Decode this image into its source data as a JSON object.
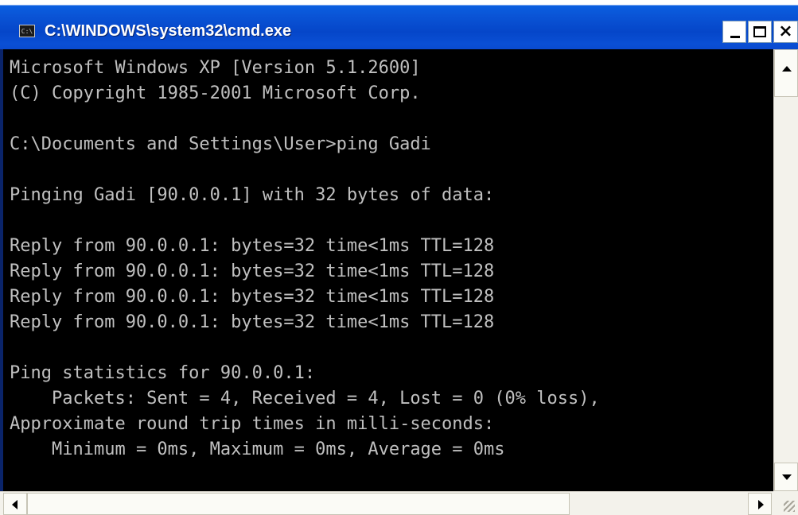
{
  "window": {
    "title": "C:\\WINDOWS\\system32\\cmd.exe",
    "icon_label": "C:\\",
    "icon": "cmd-console-icon"
  },
  "controls": {
    "minimize_icon": "minimize-icon",
    "maximize_icon": "maximize-icon",
    "close_label": "×"
  },
  "console": {
    "lines": [
      "Microsoft Windows XP [Version 5.1.2600]",
      "(C) Copyright 1985-2001 Microsoft Corp.",
      "",
      "C:\\Documents and Settings\\User>ping Gadi",
      "",
      "Pinging Gadi [90.0.0.1] with 32 bytes of data:",
      "",
      "Reply from 90.0.0.1: bytes=32 time<1ms TTL=128",
      "Reply from 90.0.0.1: bytes=32 time<1ms TTL=128",
      "Reply from 90.0.0.1: bytes=32 time<1ms TTL=128",
      "Reply from 90.0.0.1: bytes=32 time<1ms TTL=128",
      "",
      "Ping statistics for 90.0.0.1:",
      "    Packets: Sent = 4, Received = 4, Lost = 0 (0% loss),",
      "Approximate round trip times in milli-seconds:",
      "    Minimum = 0ms, Maximum = 0ms, Average = 0ms"
    ]
  },
  "colors": {
    "title_bar": "#0a54d6",
    "console_bg": "#000000",
    "console_text": "#c0c0c0"
  }
}
